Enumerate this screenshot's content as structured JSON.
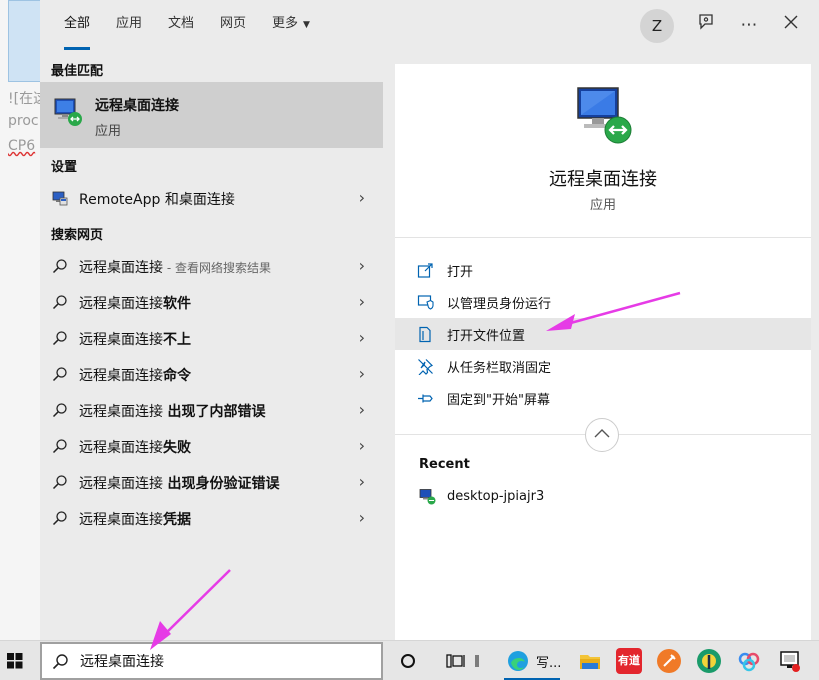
{
  "background_page": {
    "lines": [
      "![在这",
      "proc",
      "CP6"
    ]
  },
  "tabs": [
    {
      "label": "全部",
      "active": true
    },
    {
      "label": "应用",
      "active": false
    },
    {
      "label": "文档",
      "active": false
    },
    {
      "label": "网页",
      "active": false
    },
    {
      "label": "更多",
      "active": false
    }
  ],
  "avatar_letter": "Z",
  "top_icons": [
    "feedback-icon",
    "more-icon",
    "close-icon"
  ],
  "left": {
    "best_match_header": "最佳匹配",
    "best_match": {
      "name": "远程桌面连接",
      "type": "应用",
      "icon": "remote-desktop-icon"
    },
    "settings_header": "设置",
    "settings_items": [
      {
        "label": "RemoteApp 和桌面连接",
        "icon": "remoteapp-icon"
      }
    ],
    "web_header": "搜索网页",
    "web_items": [
      {
        "prefix": "远程桌面连接",
        "suffix": "",
        "sub": " - 查看网络搜索结果"
      },
      {
        "prefix": "远程桌面连接",
        "suffix": "软件",
        "sub": ""
      },
      {
        "prefix": "远程桌面连接",
        "suffix": "不上",
        "sub": ""
      },
      {
        "prefix": "远程桌面连接",
        "suffix": "命令",
        "sub": ""
      },
      {
        "prefix": "远程桌面连接 ",
        "suffix": "出现了内部错误",
        "sub": ""
      },
      {
        "prefix": "远程桌面连接",
        "suffix": "失败",
        "sub": ""
      },
      {
        "prefix": "远程桌面连接 ",
        "suffix": "出现身份验证错误",
        "sub": ""
      },
      {
        "prefix": "远程桌面连接",
        "suffix": "凭据",
        "sub": ""
      }
    ]
  },
  "right": {
    "title": "远程桌面连接",
    "type": "应用",
    "actions": [
      {
        "label": "打开",
        "icon": "open-icon"
      },
      {
        "label": "以管理员身份运行",
        "icon": "run-as-admin-icon"
      },
      {
        "label": "打开文件位置",
        "icon": "file-location-icon"
      },
      {
        "label": "从任务栏取消固定",
        "icon": "unpin-taskbar-icon"
      },
      {
        "label": "固定到\"开始\"屏幕",
        "icon": "pin-start-icon"
      }
    ],
    "recent_header": "Recent",
    "recent_items": [
      {
        "label": "desktop-jpiajr3",
        "icon": "remote-desktop-icon"
      }
    ]
  },
  "taskbar": {
    "search_value": "远程桌面连接",
    "edge_label": "写...",
    "youdao_label": "有道",
    "icons": [
      "windows-start-icon",
      "cortana-icon",
      "task-view-icon",
      "edge-icon",
      "file-explorer-icon",
      "youdao-icon",
      "orange-app-icon",
      "green-app-icon",
      "baidu-netdisk-icon",
      "remote-assistant-icon"
    ]
  },
  "colors": {
    "accent": "#0063b1",
    "annotation_arrow": "#e63be6",
    "menu_bg": "#ebebeb",
    "highlight": "#cfcfcf"
  }
}
